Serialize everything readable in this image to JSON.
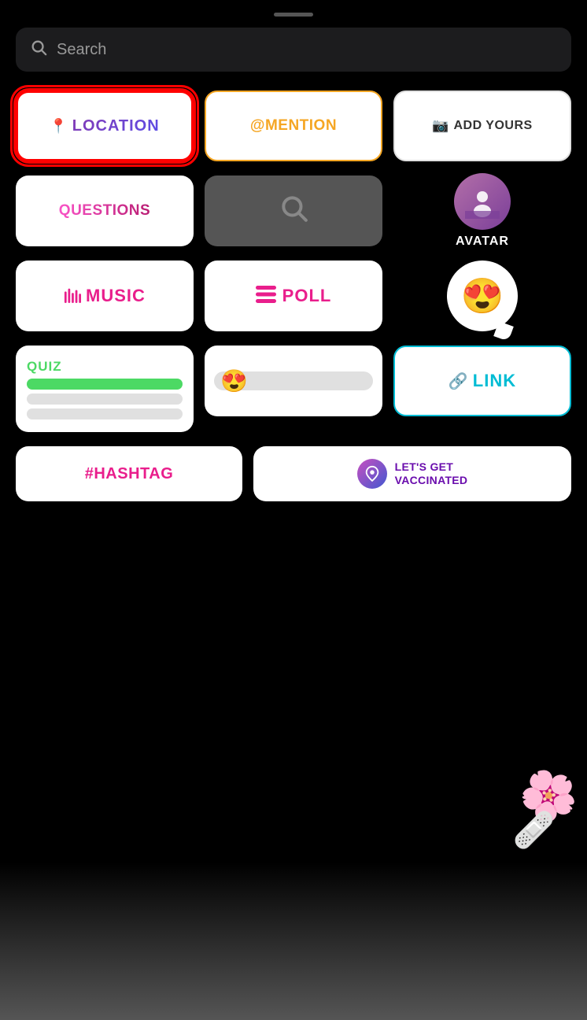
{
  "dragHandle": true,
  "search": {
    "placeholder": "Search"
  },
  "stickers": {
    "row1": [
      {
        "id": "location",
        "label": "LOCATION",
        "icon": "📍",
        "type": "location",
        "highlighted": true
      },
      {
        "id": "mention",
        "label": "@MENTION",
        "type": "mention"
      },
      {
        "id": "addyours",
        "label": "ADD YOURS",
        "icon": "📷",
        "type": "addyours"
      }
    ],
    "row2": [
      {
        "id": "questions",
        "label": "QUESTIONS",
        "type": "questions"
      },
      {
        "id": "search",
        "type": "search-gray"
      },
      {
        "id": "avatar",
        "label": "AVATAR",
        "type": "avatar"
      }
    ],
    "row3": [
      {
        "id": "music",
        "label": "MUSIC",
        "icon": "♫",
        "type": "music"
      },
      {
        "id": "poll",
        "label": "POLL",
        "type": "poll"
      },
      {
        "id": "emoji-reaction",
        "emoji": "😍",
        "type": "emoji-reaction"
      }
    ],
    "row4": [
      {
        "id": "quiz",
        "label": "QUIZ",
        "type": "quiz"
      },
      {
        "id": "emoji-slider",
        "emoji": "😍",
        "type": "emoji-slider"
      },
      {
        "id": "link",
        "label": "LINK",
        "icon": "🔗",
        "type": "link"
      }
    ],
    "bottomRow": [
      {
        "id": "hashtag",
        "label": "#HASHTAG",
        "type": "hashtag"
      },
      {
        "id": "vaccinated",
        "label": "LET'S GET\nVACCINATED",
        "type": "vaccinated"
      }
    ]
  }
}
